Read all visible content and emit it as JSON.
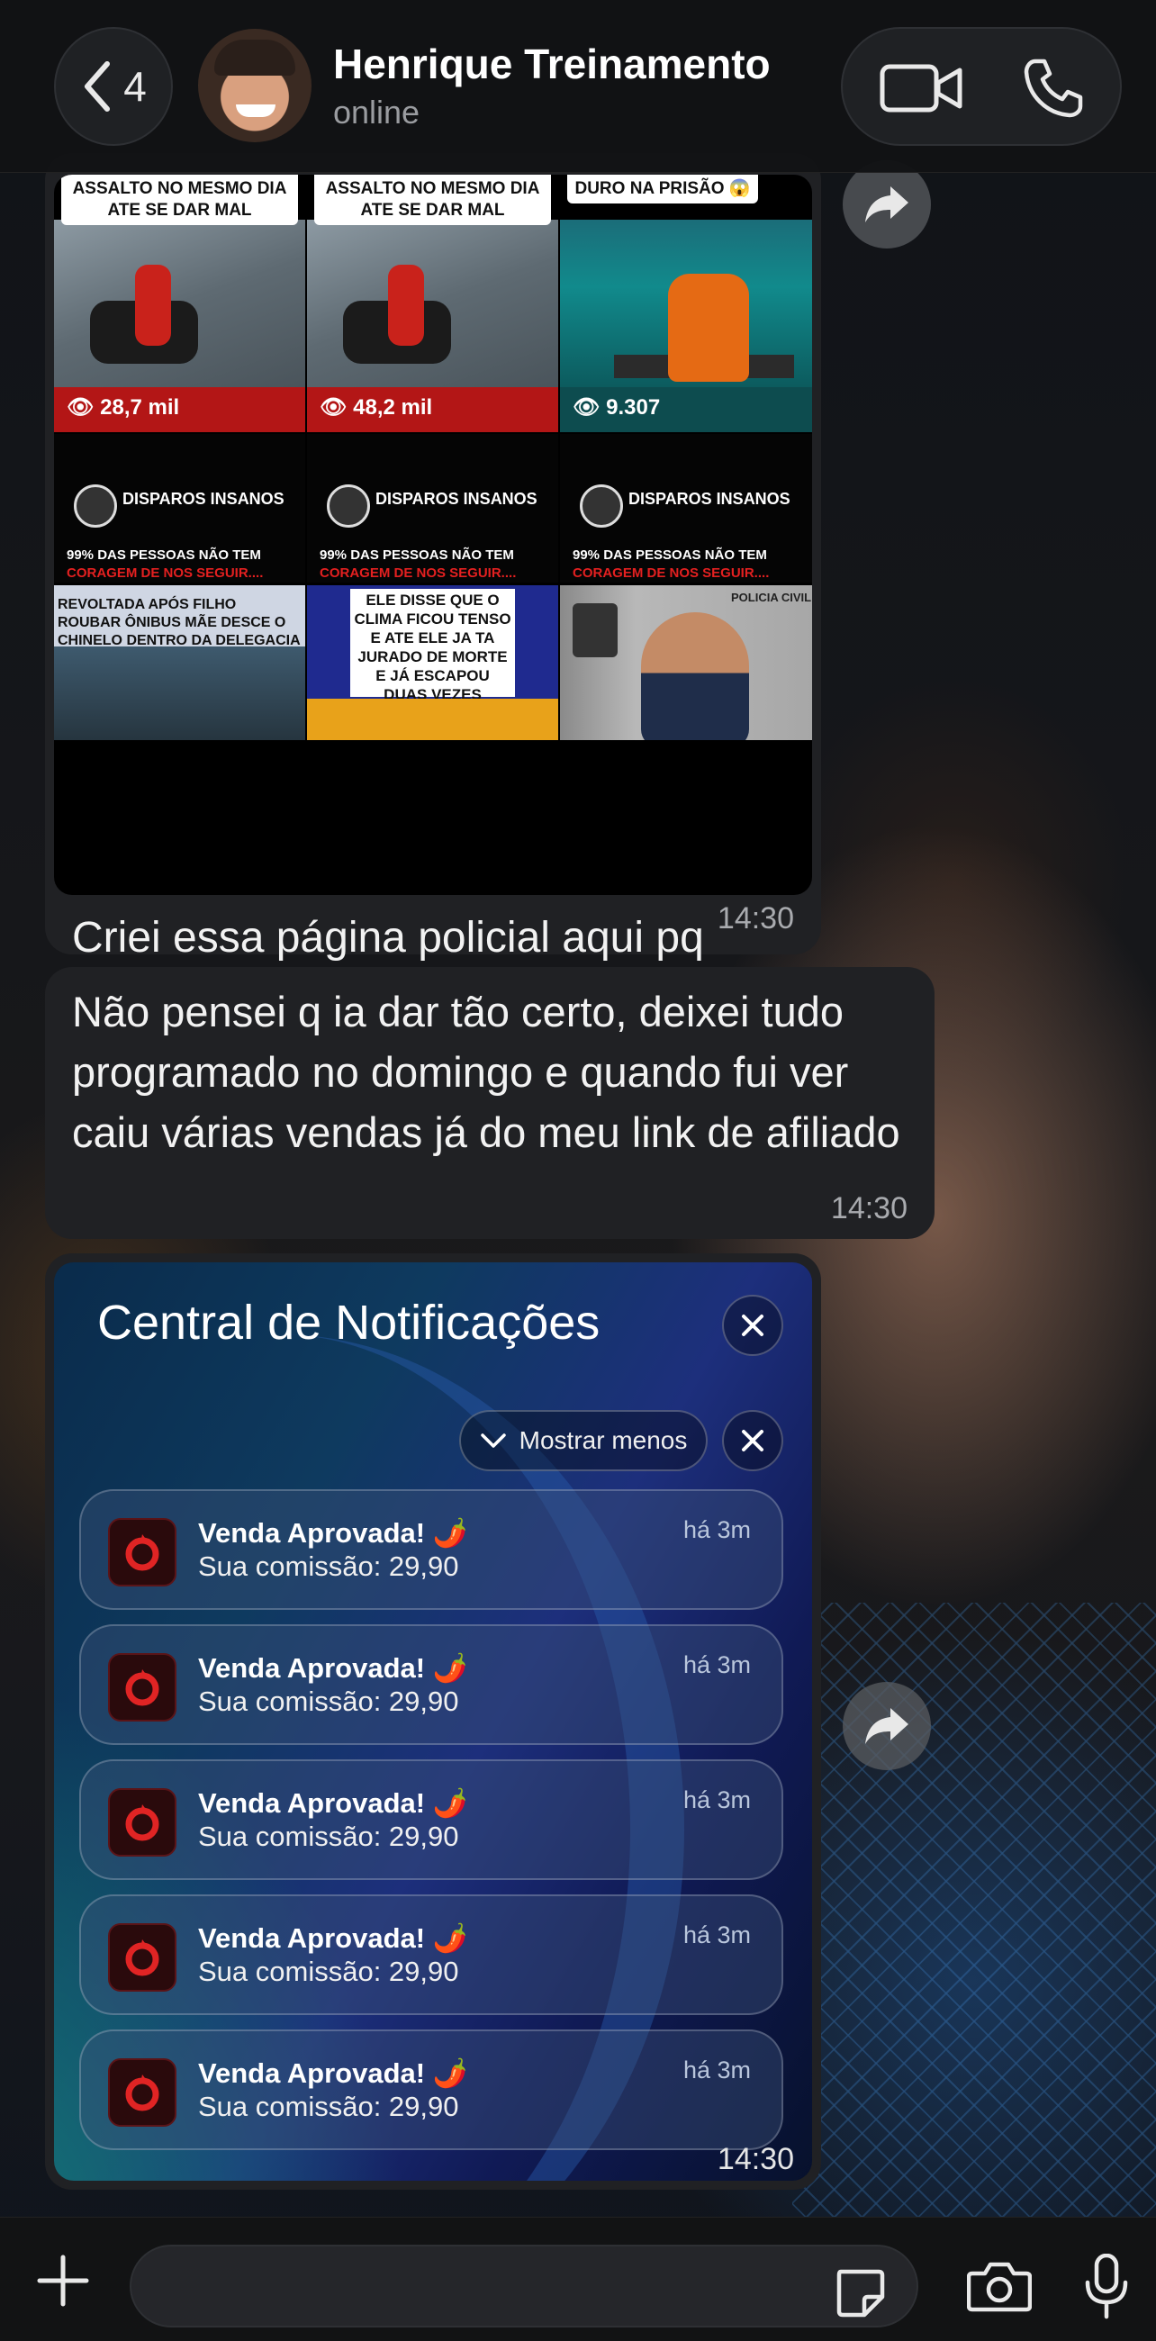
{
  "header": {
    "back_count": "4",
    "contact_name": "Henrique Treinamento",
    "contact_status": "online"
  },
  "media_message": {
    "tiles_top": [
      {
        "caption": "ASSALTO NO MESMO DIA ATE SE DAR MAL",
        "views": "28,7 mil"
      },
      {
        "caption": "ASSALTO NO MESMO DIA ATE SE DAR MAL",
        "views": "48,2 mil"
      },
      {
        "caption": "DURO NA PRISÃO 😱",
        "views": "9.307"
      }
    ],
    "tiles_bottom": [
      {
        "brand": "DISPAROS INSANOS",
        "line1": "99% DAS PESSOAS NÃO TEM",
        "line2": "CORAGEM DE NOS SEGUIR....",
        "headline": "REVOLTADA APÓS FILHO ROUBAR ÔNIBUS MÃE DESCE O CHINELO DENTRO DA DELEGACIA"
      },
      {
        "brand": "DISPAROS INSANOS",
        "line1": "99% DAS PESSOAS NÃO TEM",
        "line2": "CORAGEM DE NOS SEGUIR....",
        "headline": "ELE DISSE QUE O CLIMA FICOU TENSO E ATE ELE JA TA JURADO DE MORTE E JÁ ESCAPOU DUAS VEZES"
      },
      {
        "brand": "DISPAROS INSANOS",
        "line1": "99% DAS PESSOAS NÃO TEM",
        "line2": "CORAGEM DE NOS SEGUIR....",
        "headline": "POLICIA CIVIL"
      }
    ],
    "caption": "Criei essa página policial aqui pq sou pm e curto ver bandido se dando mal kkkkkk",
    "time": "14:30"
  },
  "text_message": {
    "text": "Não pensei q ia dar tão certo, deixei tudo programado no domingo e quando fui ver caiu várias vendas já do meu link de afiliado",
    "time": "14:30"
  },
  "notification_message": {
    "title": "Central de Notificações",
    "show_less": "Mostrar menos",
    "notifications": [
      {
        "title": "Venda Aprovada! 🌶️",
        "body": "Sua comissão: 29,90",
        "time": "há 3m"
      },
      {
        "title": "Venda Aprovada! 🌶️",
        "body": "Sua comissão: 29,90",
        "time": "há 3m"
      },
      {
        "title": "Venda Aprovada! 🌶️",
        "body": "Sua comissão: 29,90",
        "time": "há 3m"
      },
      {
        "title": "Venda Aprovada! 🌶️",
        "body": "Sua comissão: 29,90",
        "time": "há 3m"
      },
      {
        "title": "Venda Aprovada! 🌶️",
        "body": "Sua comissão: 29,90",
        "time": "há 3m"
      }
    ],
    "time": "14:30"
  },
  "composer": {
    "input_value": ""
  }
}
